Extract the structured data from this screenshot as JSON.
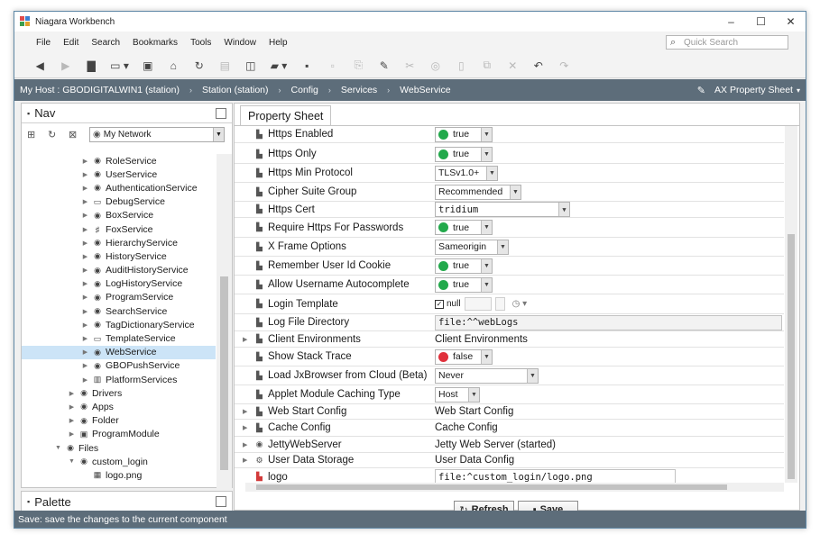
{
  "window": {
    "title": "Niagara Workbench",
    "minimize": "–",
    "maximize": "☐",
    "close": "✕"
  },
  "menu": [
    "File",
    "Edit",
    "Search",
    "Bookmarks",
    "Tools",
    "Window",
    "Help"
  ],
  "quick_search": {
    "placeholder": "Quick Search"
  },
  "toolbar": [
    "back-icon",
    "forward-icon",
    "home-folder-icon",
    "view-icon",
    "station-icon",
    "home-icon",
    "refresh-icon",
    "copy-icon",
    "side-bar-icon",
    "open-folder-icon",
    "save-icon",
    "save-all-icon",
    "find-icon",
    "edit-icon",
    "cut-icon",
    "copy2-icon",
    "paste-icon",
    "duplicate-icon",
    "delete-icon",
    "undo-icon",
    "redo-icon"
  ],
  "breadcrumb": [
    "My Host : GBODIGITALWIN1 (station)",
    "Station (station)",
    "Config",
    "Services",
    "WebService"
  ],
  "view_selector": "AX Property Sheet",
  "nav": {
    "title": "Nav",
    "network": "My Network",
    "tree": [
      {
        "label": "RoleService",
        "selected": false
      },
      {
        "label": "UserService",
        "selected": false
      },
      {
        "label": "AuthenticationService",
        "selected": false
      },
      {
        "label": "DebugService",
        "selected": false
      },
      {
        "label": "BoxService",
        "selected": false
      },
      {
        "label": "FoxService",
        "selected": false
      },
      {
        "label": "HierarchyService",
        "selected": false
      },
      {
        "label": "HistoryService",
        "selected": false
      },
      {
        "label": "AuditHistoryService",
        "selected": false
      },
      {
        "label": "LogHistoryService",
        "selected": false
      },
      {
        "label": "ProgramService",
        "selected": false
      },
      {
        "label": "SearchService",
        "selected": false
      },
      {
        "label": "TagDictionaryService",
        "selected": false
      },
      {
        "label": "TemplateService",
        "selected": false
      },
      {
        "label": "WebService",
        "selected": true
      },
      {
        "label": "GBOPushService",
        "selected": false
      },
      {
        "label": "PlatformServices",
        "selected": false
      },
      {
        "label": "Drivers",
        "selected": false
      },
      {
        "label": "Apps",
        "selected": false
      },
      {
        "label": "Folder",
        "selected": false
      },
      {
        "label": "ProgramModule",
        "selected": false
      },
      {
        "label": "Files",
        "selected": false
      },
      {
        "label": "custom_login",
        "selected": false
      },
      {
        "label": "logo.png",
        "selected": false
      }
    ]
  },
  "palette": {
    "title": "Palette"
  },
  "sheet": {
    "tab": "Property Sheet",
    "rows": [
      {
        "name": "Https Enabled",
        "value": "true"
      },
      {
        "name": "Https Only",
        "value": "true"
      },
      {
        "name": "Https Min Protocol",
        "value": "TLSv1.0+"
      },
      {
        "name": "Cipher Suite Group",
        "value": "Recommended"
      },
      {
        "name": "Https Cert",
        "value": "tridium"
      },
      {
        "name": "Require Https For Passwords",
        "value": "true"
      },
      {
        "name": "X Frame Options",
        "value": "Sameorigin"
      },
      {
        "name": "Remember User Id Cookie",
        "value": "true"
      },
      {
        "name": "Allow Username Autocomplete",
        "value": "true"
      },
      {
        "name": "Login Template",
        "value": "null"
      },
      {
        "name": "Log File Directory",
        "value": "file:^^webLogs"
      },
      {
        "name": "Client Environments",
        "value": "Client Environments"
      },
      {
        "name": "Show Stack Trace",
        "value": "false"
      },
      {
        "name": "Load JxBrowser from Cloud (Beta)",
        "value": "Never"
      },
      {
        "name": "Applet Module Caching Type",
        "value": "Host"
      },
      {
        "name": "Web Start Config",
        "value": "Web Start Config"
      },
      {
        "name": "Cache Config",
        "value": "Cache Config"
      },
      {
        "name": "JettyWebServer",
        "value": "Jetty Web Server (started)"
      },
      {
        "name": "User Data Storage",
        "value": "User Data Config"
      },
      {
        "name": "logo",
        "value": "file:^custom_login/logo.png"
      }
    ]
  },
  "buttons": {
    "refresh": "Refresh",
    "save": "Save"
  },
  "status": "Save: save the changes to the current component",
  "colors": {
    "true_dot": "#22a94b",
    "false_dot": "#e0303b",
    "header_bar": "#5d6d7a",
    "selection": "#cce4f7"
  }
}
